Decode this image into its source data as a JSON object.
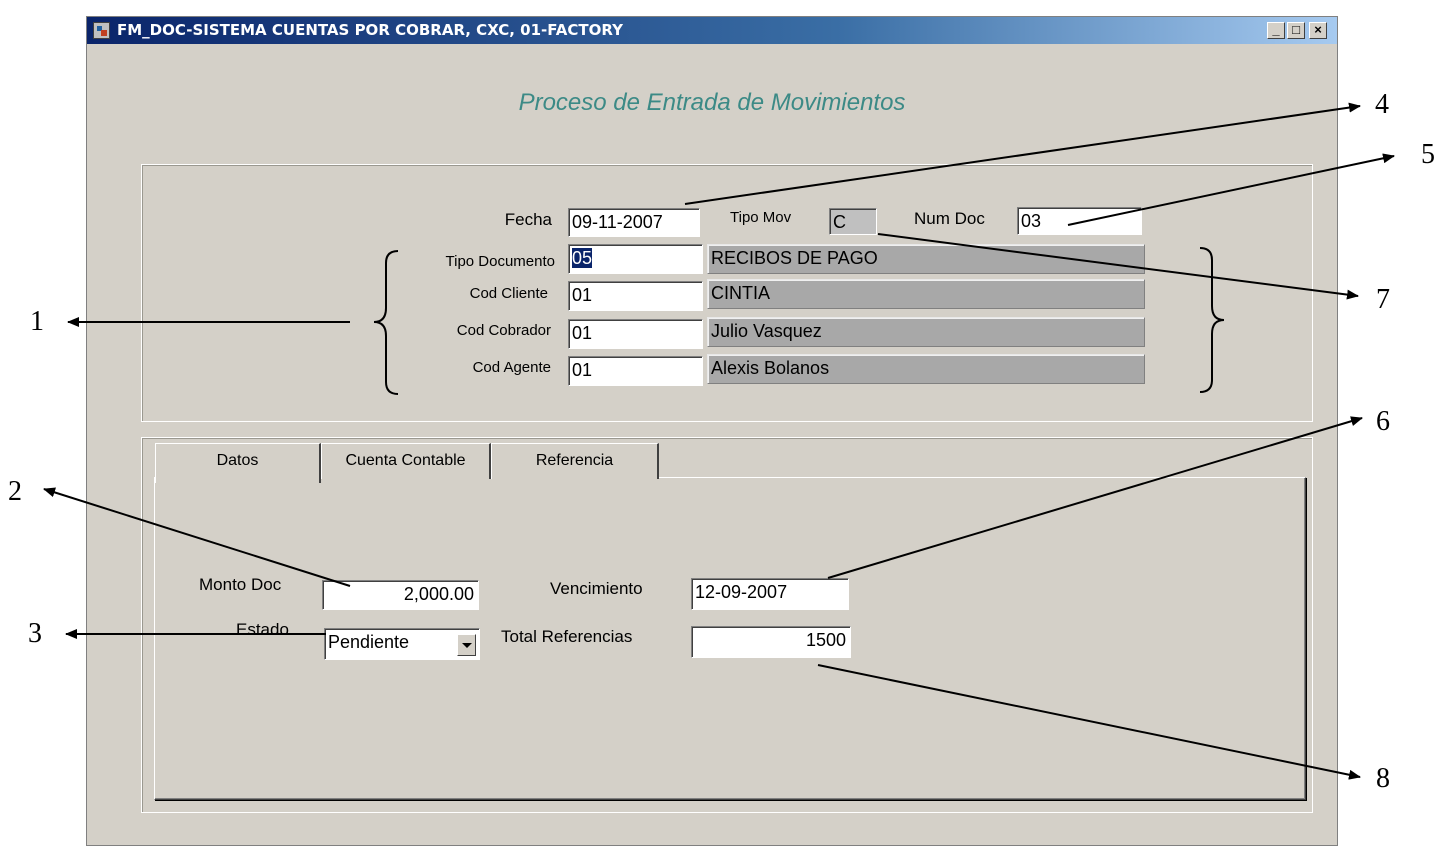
{
  "window": {
    "title": "FM_DOC-SISTEMA CUENTAS POR COBRAR, CXC, 01-FACTORY",
    "controls": {
      "minimize": "_",
      "maximize": "□",
      "close": "×"
    }
  },
  "heading": "Proceso de Entrada de Movimientos",
  "header_form": {
    "fecha_label": "Fecha",
    "fecha_value": "09-11-2007",
    "tipo_mov_label": "Tipo Mov",
    "tipo_mov_value": "C",
    "num_doc_label": "Num Doc",
    "num_doc_value": "03",
    "rows": [
      {
        "label": "Tipo Documento",
        "code": "05",
        "description": "RECIBOS DE PAGO"
      },
      {
        "label": "Cod  Cliente",
        "code": "01",
        "description": "CINTIA"
      },
      {
        "label": "Cod Cobrador",
        "code": "01",
        "description": "Julio Vasquez"
      },
      {
        "label": "Cod Agente",
        "code": "01",
        "description": "Alexis Bolanos"
      }
    ]
  },
  "tabs": [
    {
      "label": "Datos",
      "active": true
    },
    {
      "label": "Cuenta Contable",
      "active": false
    },
    {
      "label": "Referencia",
      "active": false
    }
  ],
  "datos": {
    "monto_doc_label": "Monto Doc",
    "monto_doc_value": "2,000.00",
    "estado_label": "Estado",
    "estado_value": "Pendiente",
    "vencimiento_label": "Vencimiento",
    "vencimiento_value": "12-09-2007",
    "total_ref_label": "Total Referencias",
    "total_ref_value": "1500"
  },
  "callouts": [
    "1",
    "2",
    "3",
    "4",
    "5",
    "6",
    "7",
    "8"
  ]
}
